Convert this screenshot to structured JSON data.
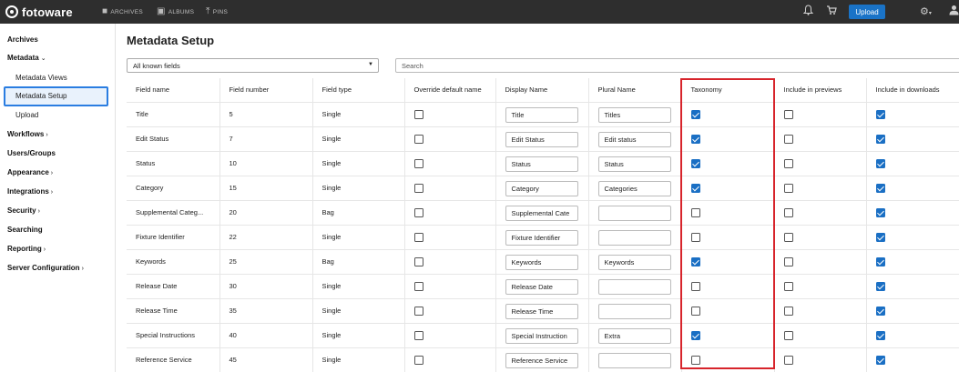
{
  "topbar": {
    "logo_text": "fotoware",
    "nav": [
      {
        "label": "ARCHIVES",
        "icon": "folder-icon"
      },
      {
        "label": "ALBUMS",
        "icon": "album-icon"
      },
      {
        "label": "PINS",
        "icon": "pin-icon"
      }
    ],
    "upload_label": "Upload"
  },
  "sidebar": {
    "archives": "Archives",
    "metadata": "Metadata",
    "metadata_views": "Metadata Views",
    "metadata_setup": "Metadata Setup",
    "upload": "Upload",
    "workflows": "Workflows",
    "users_groups": "Users/Groups",
    "appearance": "Appearance",
    "integrations": "Integrations",
    "security": "Security",
    "searching": "Searching",
    "reporting": "Reporting",
    "server_configuration": "Server Configuration"
  },
  "page": {
    "title": "Metadata Setup",
    "filter_value": "All known fields",
    "search_placeholder": "Search"
  },
  "table": {
    "headers": {
      "field_name": "Field name",
      "field_number": "Field number",
      "field_type": "Field type",
      "override": "Override default name",
      "display_name": "Display Name",
      "plural_name": "Plural Name",
      "taxonomy": "Taxonomy",
      "include_previews": "Include in previews",
      "include_downloads": "Include in downloads"
    },
    "rows": [
      {
        "name": "Title",
        "number": "5",
        "type": "Single",
        "override": false,
        "display": "Title",
        "plural": "Titles",
        "taxonomy": true,
        "previews": false,
        "downloads": true
      },
      {
        "name": "Edit Status",
        "number": "7",
        "type": "Single",
        "override": false,
        "display": "Edit Status",
        "plural": "Edit status",
        "taxonomy": true,
        "previews": false,
        "downloads": true
      },
      {
        "name": "Status",
        "number": "10",
        "type": "Single",
        "override": false,
        "display": "Status",
        "plural": "Status",
        "taxonomy": true,
        "previews": false,
        "downloads": true
      },
      {
        "name": "Category",
        "number": "15",
        "type": "Single",
        "override": false,
        "display": "Category",
        "plural": "Categories",
        "taxonomy": true,
        "previews": false,
        "downloads": true
      },
      {
        "name": "Supplemental Categ...",
        "number": "20",
        "type": "Bag",
        "override": false,
        "display": "Supplemental Cate",
        "plural": "",
        "taxonomy": false,
        "previews": false,
        "downloads": true
      },
      {
        "name": "Fixture Identifier",
        "number": "22",
        "type": "Single",
        "override": false,
        "display": "Fixture Identifier",
        "plural": "",
        "taxonomy": false,
        "previews": false,
        "downloads": true
      },
      {
        "name": "Keywords",
        "number": "25",
        "type": "Bag",
        "override": false,
        "display": "Keywords",
        "plural": "Keywords",
        "taxonomy": true,
        "previews": false,
        "downloads": true
      },
      {
        "name": "Release Date",
        "number": "30",
        "type": "Single",
        "override": false,
        "display": "Release Date",
        "plural": "",
        "taxonomy": false,
        "previews": false,
        "downloads": true
      },
      {
        "name": "Release Time",
        "number": "35",
        "type": "Single",
        "override": false,
        "display": "Release Time",
        "plural": "",
        "taxonomy": false,
        "previews": false,
        "downloads": true
      },
      {
        "name": "Special Instructions",
        "number": "40",
        "type": "Single",
        "override": false,
        "display": "Special Instruction",
        "plural": "Extra",
        "taxonomy": true,
        "previews": false,
        "downloads": true
      },
      {
        "name": "Reference Service",
        "number": "45",
        "type": "Single",
        "override": false,
        "display": "Reference Service",
        "plural": "",
        "taxonomy": false,
        "previews": false,
        "downloads": true
      }
    ]
  },
  "colors": {
    "topbar": "#2e2e2e",
    "accent": "#1a73c7",
    "highlight": "#d7242b"
  }
}
